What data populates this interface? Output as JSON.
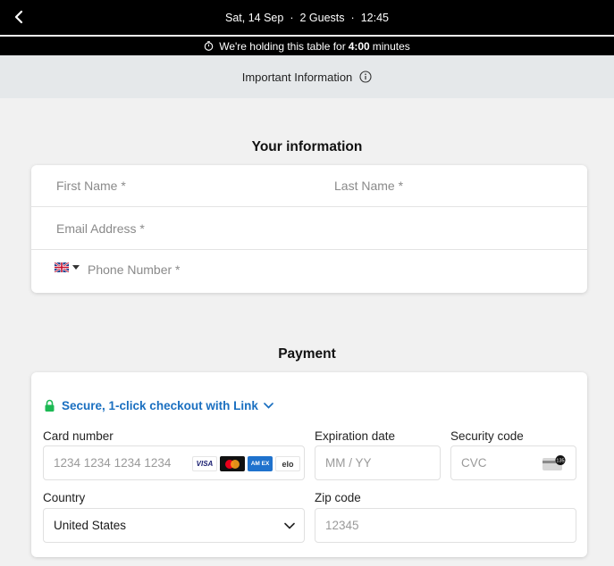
{
  "header": {
    "date": "Sat, 14 Sep",
    "guests": "2 Guests",
    "time": "12:45",
    "separator": "·"
  },
  "hold": {
    "text_before": "We're holding this table for",
    "time": "4:00",
    "text_after": "minutes"
  },
  "info_link": "Important Information",
  "your_info": {
    "title": "Your information",
    "first_name_ph": "First Name *",
    "last_name_ph": "Last Name *",
    "email_ph": "Email Address *",
    "phone_ph": "Phone Number *"
  },
  "payment": {
    "title": "Payment",
    "link_text": "Secure, 1-click checkout with Link",
    "card_number_label": "Card number",
    "card_number_ph": "1234 1234 1234 1234",
    "expiry_label": "Expiration date",
    "expiry_ph": "MM / YY",
    "security_label": "Security code",
    "cvc_ph": "CVC",
    "country_label": "Country",
    "country_value": "United States",
    "zip_label": "Zip code",
    "zip_ph": "12345",
    "brands": {
      "visa": "VISA",
      "amex": "AM EX",
      "elo": "elo"
    },
    "cvc_badge": "135"
  },
  "colors": {
    "link_blue": "#1a6fc0",
    "lock_green": "#1db954",
    "header_bg": "#000000",
    "info_bg": "#e5e8ea"
  }
}
